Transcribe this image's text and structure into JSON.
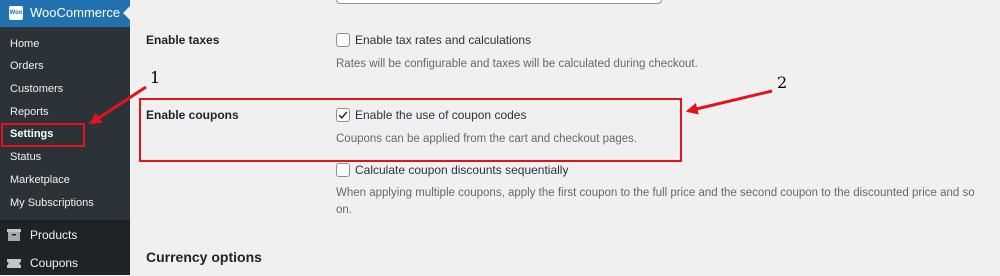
{
  "sidebar": {
    "app_title": "WooCommerce",
    "logo_text": "Woo",
    "items": [
      {
        "label": "Home",
        "active": false
      },
      {
        "label": "Orders",
        "active": false
      },
      {
        "label": "Customers",
        "active": false
      },
      {
        "label": "Reports",
        "active": false
      },
      {
        "label": "Settings",
        "active": true
      },
      {
        "label": "Status",
        "active": false
      },
      {
        "label": "Marketplace",
        "active": false
      },
      {
        "label": "My Subscriptions",
        "active": false
      }
    ],
    "menus": [
      {
        "label": "Products",
        "icon": "box-icon"
      },
      {
        "label": "Coupons",
        "icon": "ticket-icon"
      }
    ]
  },
  "settings": {
    "taxes": {
      "label": "Enable taxes",
      "checkbox_label": "Enable tax rates and calculations",
      "checked": false,
      "description": "Rates will be configurable and taxes will be calculated during checkout."
    },
    "coupons": {
      "label": "Enable coupons",
      "checkbox_label": "Enable the use of coupon codes",
      "checked": true,
      "description": "Coupons can be applied from the cart and checkout pages.",
      "sequential_label": "Calculate coupon discounts sequentially",
      "sequential_checked": false,
      "sequential_description_1": "When applying multiple coupons, apply the first coupon to the full price and the second coupon to the discounted price and so",
      "sequential_description_2": "on."
    },
    "currency_section_title": "Currency options"
  },
  "annotations": {
    "label_1": "1",
    "label_2": "2",
    "color": "#e2141b"
  }
}
